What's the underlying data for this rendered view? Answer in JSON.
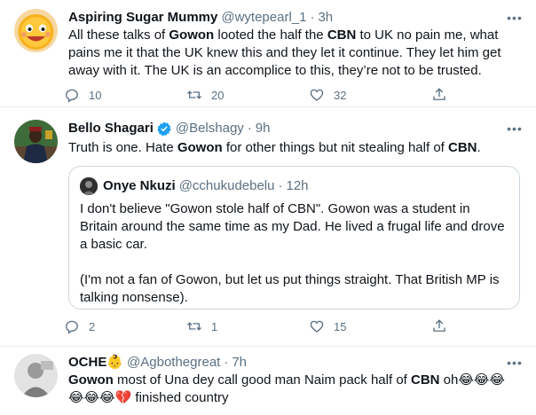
{
  "tweets": [
    {
      "name": "Aspiring Sugar Mummy",
      "handle": "@wytepearl_1",
      "dot": "·",
      "time": "3h",
      "text_segments": [
        "All these talks of ",
        "Gowon",
        " looted the half the ",
        "CBN",
        " to UK no pain me, what pains me it that the UK knew this and they let it continue. They let him get away with it. The UK is an accomplice to this, they’re not to be trusted."
      ],
      "replies": "10",
      "retweets": "20",
      "likes": "32"
    },
    {
      "name": "Bello Shagari",
      "handle": "@Belshagy",
      "dot": "·",
      "time": "9h",
      "text_segments": [
        "Truth is one. Hate ",
        "Gowon",
        " for other things but nit stealing half of ",
        "CBN",
        "."
      ],
      "quote": {
        "name": "Onye Nkuzi",
        "handle": "@cchukudebelu",
        "dot": "·",
        "time": "12h",
        "paragraph1": "I don't believe \"Gowon stole half of CBN\". Gowon was a student in Britain around the same time as my Dad. He lived a frugal life and drove a basic car.",
        "paragraph2": "(I'm not a fan of Gowon, but let us put things straight. That British MP is talking nonsense)."
      },
      "replies": "2",
      "retweets": "1",
      "likes": "15"
    },
    {
      "name": "OCHE",
      "name_emoji": "👶",
      "handle": "@Agbothegreat",
      "dot": "·",
      "time": "7h",
      "text_segments": [
        "Gowon",
        " most of Una dey call good man Naim pack half of ",
        "CBN",
        " oh😂😂😂",
        "😂😂😂💔 finished country"
      ]
    }
  ],
  "icons": {
    "reply": "reply-icon",
    "retweet": "retweet-icon",
    "like": "heart-icon",
    "share": "share-icon",
    "more": "more-icon",
    "verified": "verified-badge-icon"
  },
  "colors": {
    "text": "#0f1419",
    "secondary": "#5b7083",
    "verified": "#1da1f2",
    "border": "#e6ecf0"
  }
}
